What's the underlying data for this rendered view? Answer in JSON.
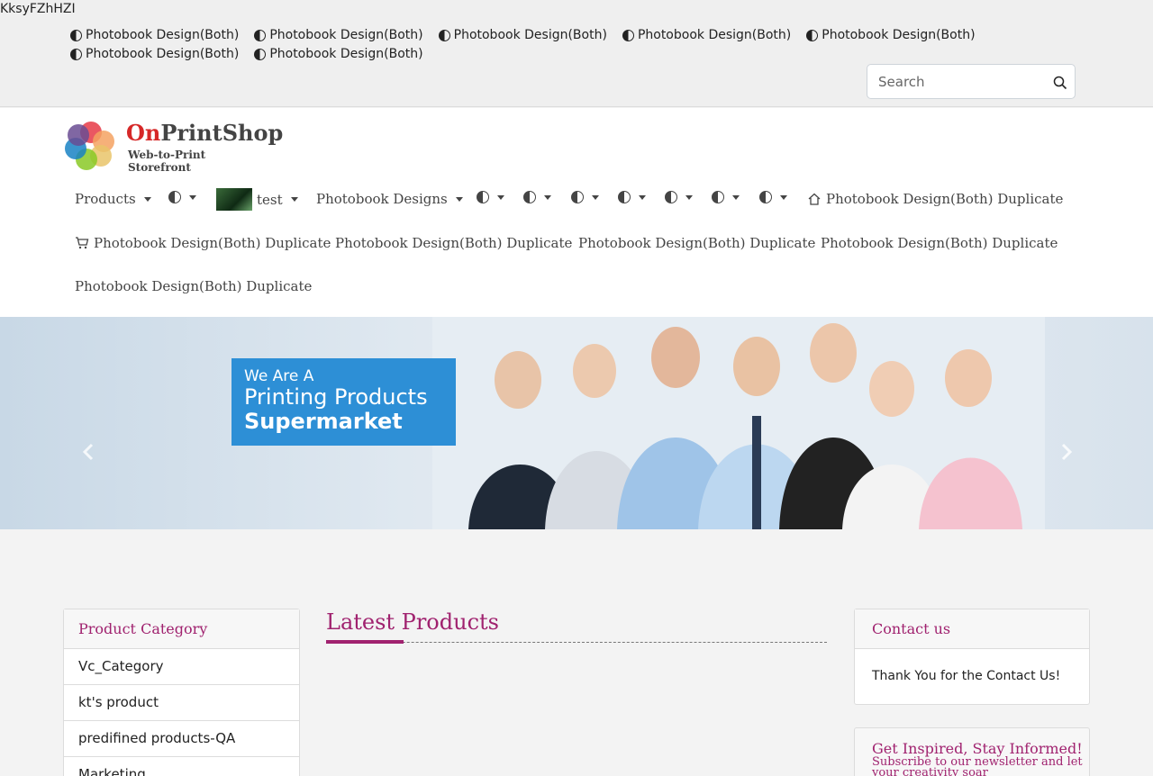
{
  "site_code": "KksyFZhHZI",
  "top_links": [
    "Photobook Design(Both)",
    "Photobook Design(Both)",
    "Photobook Design(Both)",
    "Photobook Design(Both)",
    "Photobook Design(Both)",
    "Photobook Design(Both)",
    "Photobook Design(Both)"
  ],
  "search": {
    "placeholder": "Search",
    "icon": "search-icon"
  },
  "logo": {
    "name": "OnPrintShop",
    "tagline": "Web-to-Print Storefront"
  },
  "nav": {
    "products": "Products",
    "test": "test",
    "photobook_designs": "Photobook Designs",
    "home_dup": "Photobook Design(Both) Duplicate",
    "cart_dup": "Photobook Design(Both) Duplicate",
    "dup_1": "Photobook Design(Both) Duplicate",
    "dup_2": "Photobook Design(Both) Duplicate",
    "dup_3": "Photobook Design(Both) Duplicate",
    "dup_4": "Photobook Design(Both) Duplicate"
  },
  "banner": {
    "line1": "We Are A",
    "line2": "Printing Products",
    "line3": "Supermarket"
  },
  "product_category": {
    "title": "Product Category",
    "items": [
      "Vc_Category",
      "kt's product",
      "predifined products-QA",
      "Marketing"
    ]
  },
  "latest_products": {
    "title": "Latest Products"
  },
  "contact": {
    "title": "Contact us",
    "body": "Thank You for the Contact Us!"
  },
  "newsletter": {
    "title": "Get Inspired, Stay Informed!",
    "subtitle_line1": "Subscribe to our newsletter and let",
    "subtitle_line2": "your creativity soar"
  },
  "colors": {
    "accent": "#a0226f",
    "banner_box": "#2d8fd6"
  }
}
